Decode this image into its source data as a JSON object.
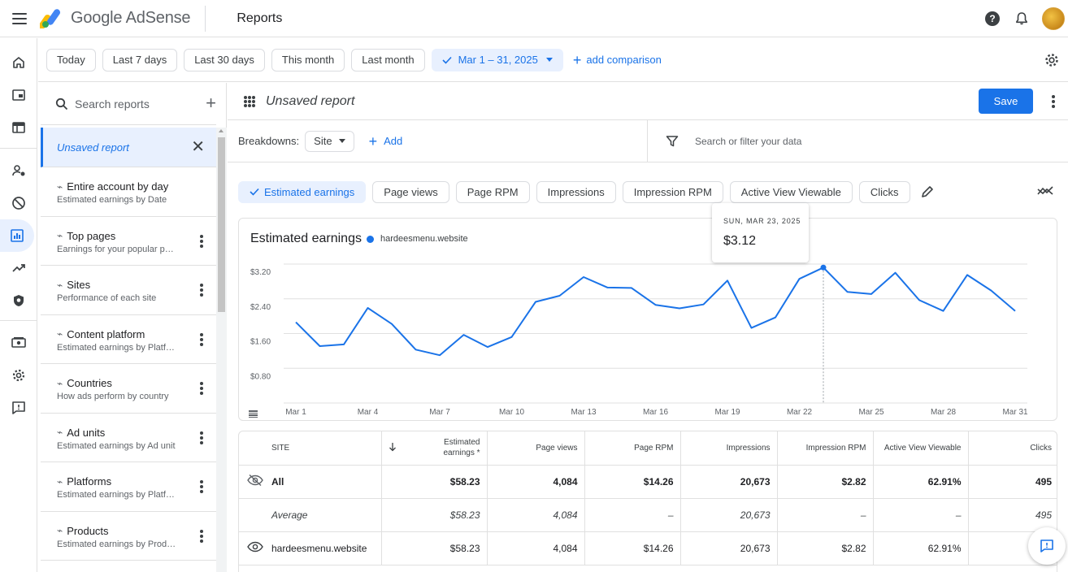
{
  "header": {
    "brand_google": "Google",
    "brand_product": "AdSense",
    "page_title": "Reports",
    "help": "?"
  },
  "date_range": {
    "presets": [
      "Today",
      "Last 7 days",
      "Last 30 days",
      "This month",
      "Last month"
    ],
    "selected_label": "Mar 1 – 31, 2025",
    "add_comparison": "add comparison"
  },
  "reports_panel": {
    "search_placeholder": "Search reports",
    "unsaved_label": "Unsaved report",
    "items": [
      {
        "title": "Entire account by day",
        "subtitle": "Estimated earnings by Date"
      },
      {
        "title": "Top pages",
        "subtitle": "Earnings for your popular pages"
      },
      {
        "title": "Sites",
        "subtitle": "Performance of each site"
      },
      {
        "title": "Content platform",
        "subtitle": "Estimated earnings by Platform"
      },
      {
        "title": "Countries",
        "subtitle": "How ads perform by country"
      },
      {
        "title": "Ad units",
        "subtitle": "Estimated earnings by Ad unit"
      },
      {
        "title": "Platforms",
        "subtitle": "Estimated earnings by Platform"
      },
      {
        "title": "Products",
        "subtitle": "Estimated earnings by Product"
      }
    ]
  },
  "report": {
    "name": "Unsaved report",
    "save_label": "Save",
    "breakdowns_label": "Breakdowns:",
    "breakdown_value": "Site",
    "add_label": "Add",
    "filter_placeholder": "Search or filter your data",
    "metrics": [
      {
        "label": "Estimated earnings",
        "selected": true
      },
      {
        "label": "Page views",
        "selected": false
      },
      {
        "label": "Page RPM",
        "selected": false
      },
      {
        "label": "Impressions",
        "selected": false
      },
      {
        "label": "Impression RPM",
        "selected": false
      },
      {
        "label": "Active View Viewable",
        "selected": false
      },
      {
        "label": "Clicks",
        "selected": false
      }
    ]
  },
  "chart_data": {
    "type": "line",
    "title": "Estimated earnings",
    "series": [
      {
        "name": "hardeesmenu.website",
        "values": [
          1.86,
          1.31,
          1.35,
          2.19,
          1.82,
          1.23,
          1.1,
          1.57,
          1.29,
          1.52,
          2.33,
          2.47,
          2.9,
          2.66,
          2.65,
          2.26,
          2.18,
          2.27,
          2.82,
          1.73,
          1.97,
          2.86,
          3.12,
          2.56,
          2.51,
          3.0,
          2.37,
          2.12,
          2.95,
          2.59,
          2.12
        ],
        "color": "#1a73e8"
      }
    ],
    "x_ticks": [
      "Mar 1",
      "Mar 4",
      "Mar 7",
      "Mar 10",
      "Mar 13",
      "Mar 16",
      "Mar 19",
      "Mar 22",
      "Mar 25",
      "Mar 28",
      "Mar 31"
    ],
    "y_ticks": [
      "$0.80",
      "$1.60",
      "$2.40",
      "$3.20"
    ],
    "ylim": [
      0,
      3.2
    ],
    "grid": true,
    "legend": "top-left",
    "hover": {
      "date": "SUN, MAR 23, 2025",
      "value": "$3.12",
      "index": 22
    }
  },
  "table": {
    "columns": [
      "SITE",
      "Estimated earnings *",
      "Page views",
      "Page RPM",
      "Impressions",
      "Impression RPM",
      "Active View Viewable",
      "Clicks"
    ],
    "rows": [
      {
        "site": "All",
        "earnings": "$58.23",
        "page_views": "4,084",
        "page_rpm": "$14.26",
        "impressions": "20,673",
        "impression_rpm": "$2.82",
        "viewable": "62.91%",
        "clicks": "495"
      },
      {
        "site": "Average",
        "earnings": "$58.23",
        "page_views": "4,084",
        "page_rpm": "–",
        "impressions": "20,673",
        "impression_rpm": "–",
        "viewable": "–",
        "clicks": "495"
      },
      {
        "site": "hardeesmenu.website",
        "earnings": "$58.23",
        "page_views": "4,084",
        "page_rpm": "$14.26",
        "impressions": "20,673",
        "impression_rpm": "$2.82",
        "viewable": "62.91%",
        "clicks": ""
      }
    ]
  },
  "colors": {
    "accent": "#1a73e8",
    "selected_bg": "#e8f0fe"
  }
}
